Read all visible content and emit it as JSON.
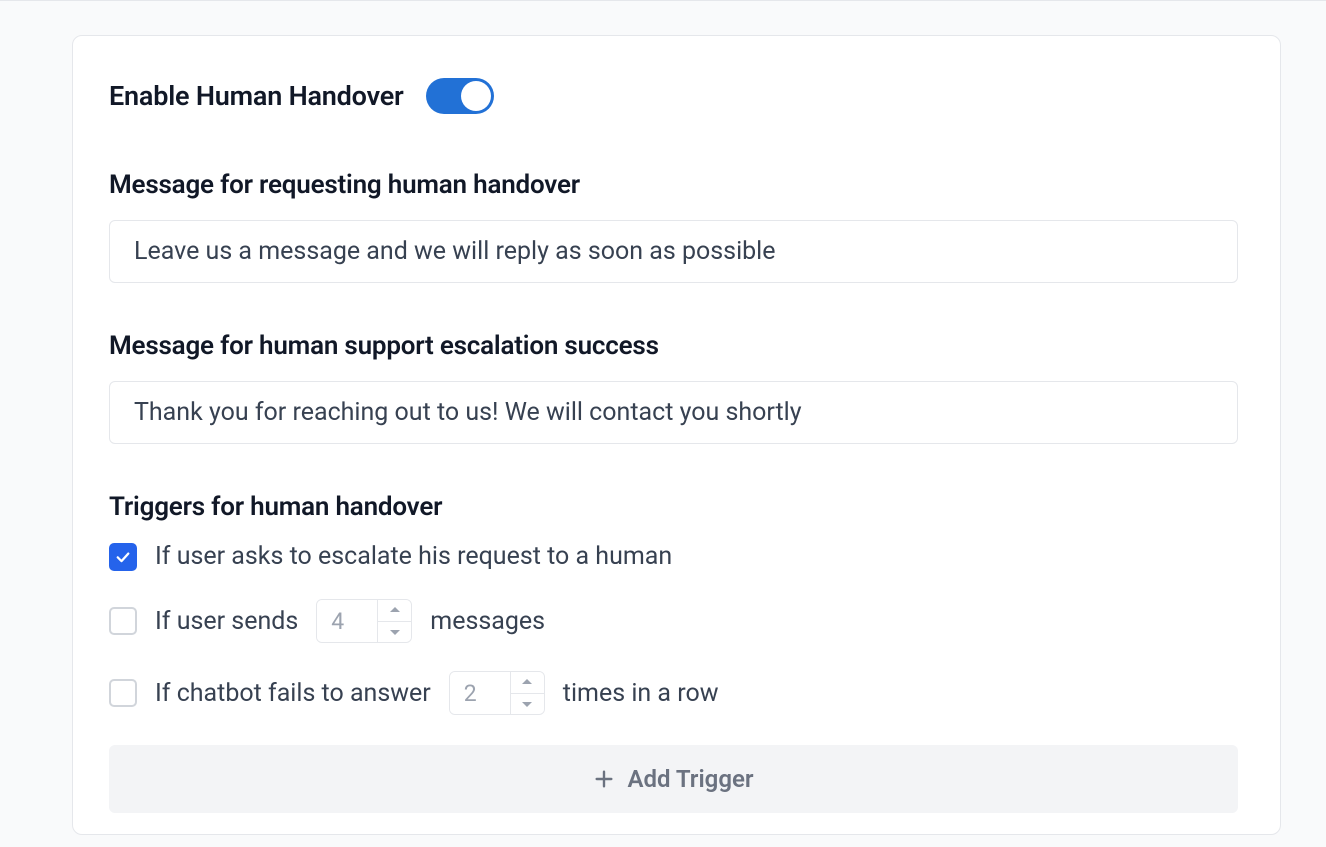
{
  "handover": {
    "enable_label": "Enable Human Handover",
    "enabled": true,
    "request_msg_label": "Message for requesting human handover",
    "request_msg_value": "Leave us a message and we will reply as soon as possible",
    "success_msg_label": "Message for human support escalation success",
    "success_msg_value": "Thank you for reaching out to us! We will contact you shortly",
    "triggers_label": "Triggers for human handover",
    "triggers": [
      {
        "checked": true,
        "text_before": "If user asks to escalate his request to a human",
        "text_after": "",
        "has_number": false
      },
      {
        "checked": false,
        "text_before": "If user sends",
        "text_after": "messages",
        "has_number": true,
        "number": "4"
      },
      {
        "checked": false,
        "text_before": "If chatbot fails to answer",
        "text_after": "times in a row",
        "has_number": true,
        "number": "2"
      }
    ],
    "add_trigger_label": "Add Trigger"
  }
}
